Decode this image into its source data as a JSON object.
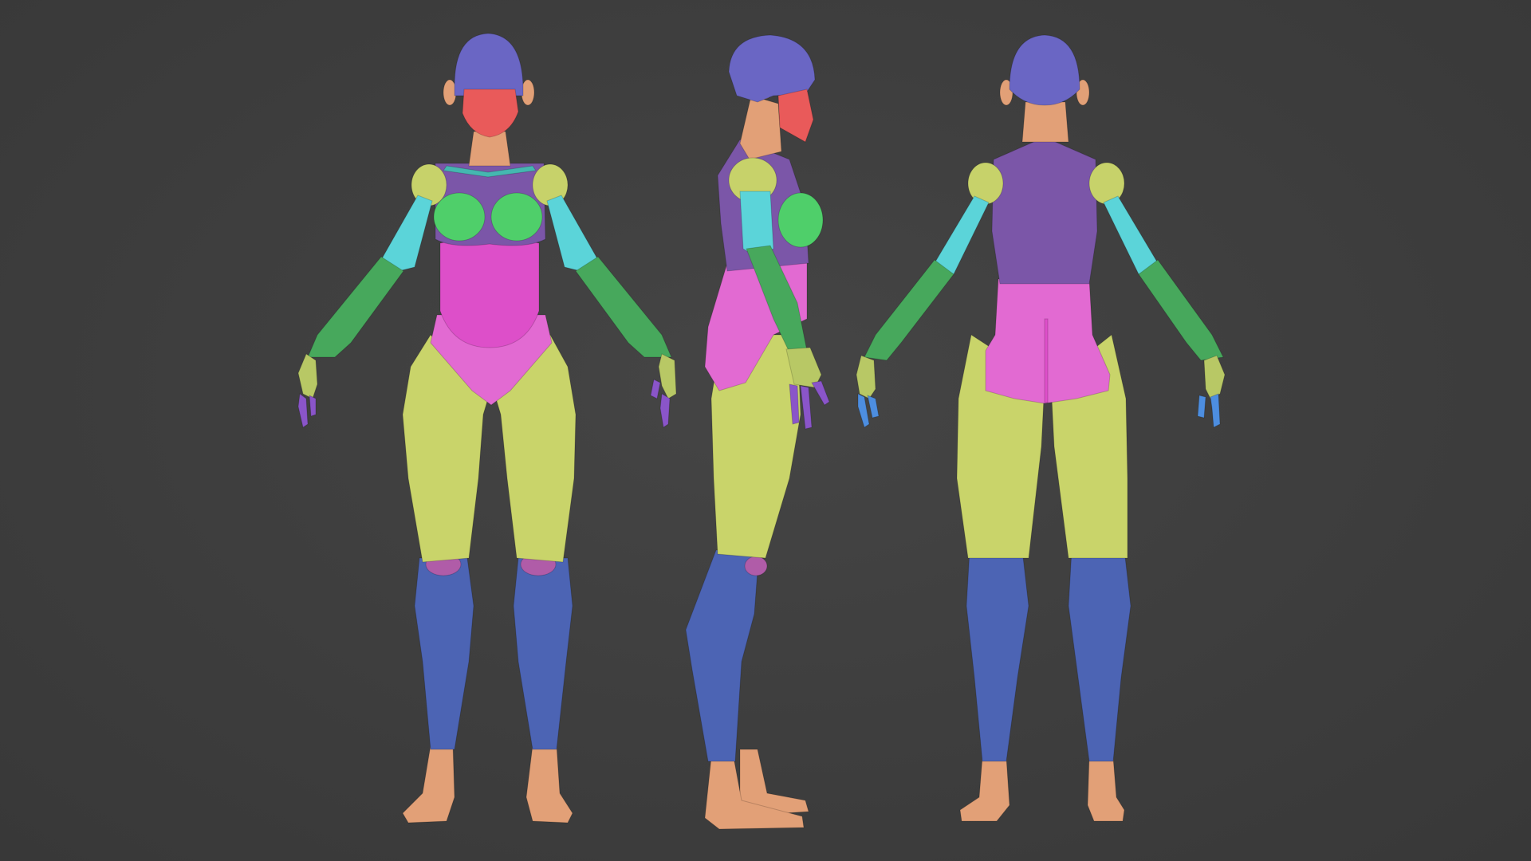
{
  "scene": {
    "background": "#3e3e3e",
    "views": [
      "front-view",
      "side-view",
      "back-view"
    ]
  },
  "colors": {
    "head": "#6a66c4",
    "mask": "#e95a5a",
    "skin": "#e2a077",
    "torso": "#7b56a8",
    "breast": "#4fcf6a",
    "belly": "#dd4fc9",
    "pelvis": "#e26ad2",
    "shoulder": "#c7d26a",
    "upper_arm": "#5bd4d9",
    "forearm": "#47a85c",
    "hand": "#b8c865",
    "finger": "#8a55c9",
    "finger_alt": "#4d8ee0",
    "thigh": "#c9d46a",
    "knee": "#b05ca8",
    "shin": "#4c64b4",
    "collar": "#45b7b0"
  }
}
